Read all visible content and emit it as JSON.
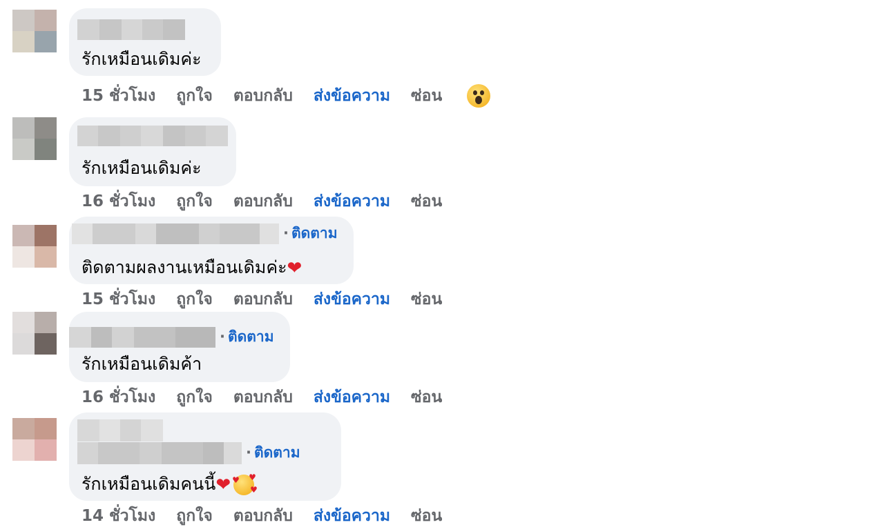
{
  "comments": [
    {
      "text": "รักเหมือนเดิมค่ะ",
      "follow": "",
      "time": "15 ชั่วโมง",
      "like": "ถูกใจ",
      "reply": "ตอบกลับ",
      "message": "ส่งข้อความ",
      "hide": "ซ่อน",
      "reaction": "wow"
    },
    {
      "text": "รักเหมือนเดิมค่ะ",
      "follow": "",
      "time": "16 ชั่วโมง",
      "like": "ถูกใจ",
      "reply": "ตอบกลับ",
      "message": "ส่งข้อความ",
      "hide": "ซ่อน"
    },
    {
      "text": "ติดตามผลงานเหมือนเดิมค่ะ",
      "follow": "ติดตาม",
      "time": "15 ชั่วโมง",
      "like": "ถูกใจ",
      "reply": "ตอบกลับ",
      "message": "ส่งข้อความ",
      "hide": "ซ่อน",
      "trailing_emoji": "heart"
    },
    {
      "text": "รักเหมือนเดิมค้า",
      "follow": "ติดตาม",
      "time": "16 ชั่วโมง",
      "like": "ถูกใจ",
      "reply": "ตอบกลับ",
      "message": "ส่งข้อความ",
      "hide": "ซ่อน"
    },
    {
      "text": "รักเหมือนเดิมคนนี้",
      "follow": "ติดตาม",
      "time": "14 ชั่วโมง",
      "like": "ถูกใจ",
      "reply": "ตอบกลับ",
      "message": "ส่งข้อความ",
      "hide": "ซ่อน",
      "trailing_emoji": "heart + smiling-face-with-hearts"
    }
  ],
  "colors": {
    "bubble": "#f0f2f5",
    "link": "#1a66c9",
    "muted": "#65676b",
    "text": "#050505"
  }
}
